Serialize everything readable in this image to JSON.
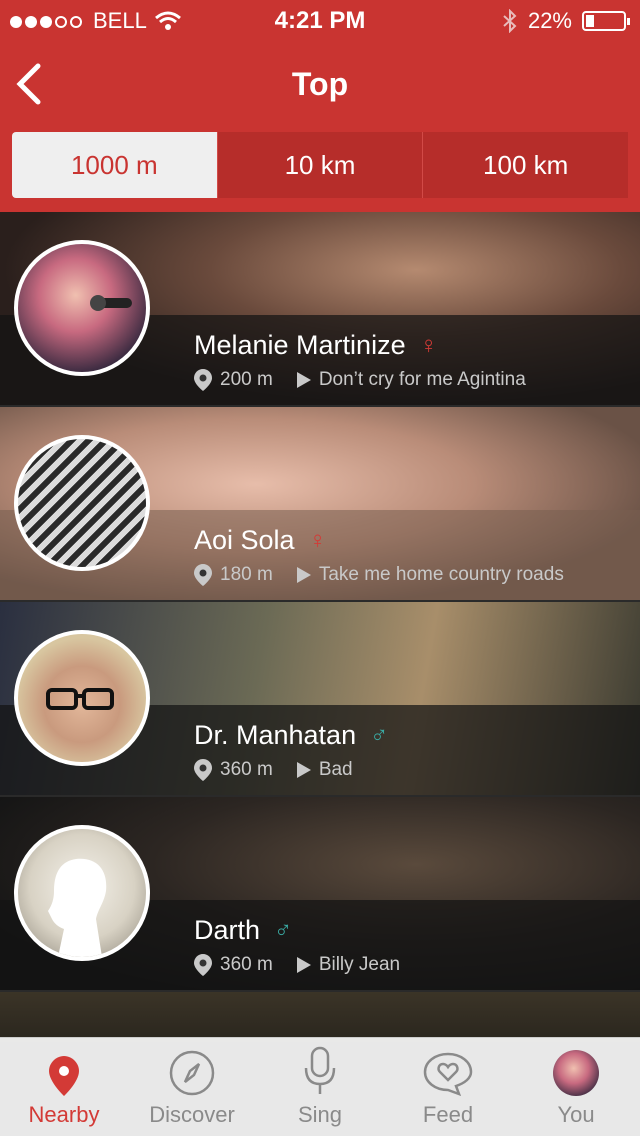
{
  "status_bar": {
    "carrier": "BELL",
    "time": "4:21 PM",
    "battery": "22%"
  },
  "header": {
    "title": "Top"
  },
  "segments": [
    "1000 m",
    "10 km",
    "100 km"
  ],
  "users": [
    {
      "name": "Melanie Martinize",
      "gender": "♀",
      "gender_color": "#d33a36",
      "distance": "200 m",
      "song": "Don’t cry for me Agintina"
    },
    {
      "name": "Aoi Sola",
      "gender": "♀",
      "gender_color": "#d33a36",
      "distance": "180 m",
      "song": "Take me home country roads"
    },
    {
      "name": "Dr. Manhatan",
      "gender": "♂",
      "gender_color": "#3aa9a2",
      "distance": "360 m",
      "song": "Bad"
    },
    {
      "name": "Darth",
      "gender": "♂",
      "gender_color": "#3aa9a2",
      "distance": "360 m",
      "song": "Billy Jean"
    }
  ],
  "tabbar": [
    "Nearby",
    "Discover",
    "Sing",
    "Feed",
    "You"
  ],
  "colors": {
    "accent": "#c93431"
  }
}
